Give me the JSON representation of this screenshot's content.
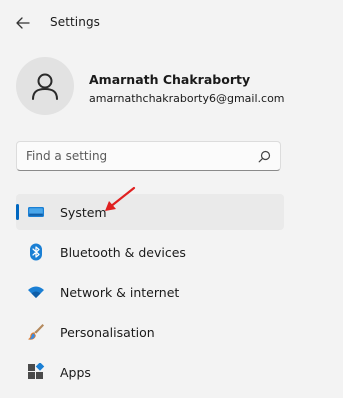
{
  "window": {
    "title": "Settings"
  },
  "user": {
    "name": "Amarnath Chakraborty",
    "email": "amarnathchakraborty6@gmail.com"
  },
  "search": {
    "placeholder": "Find a setting",
    "value": ""
  },
  "nav": {
    "items": [
      {
        "label": "System",
        "icon": "monitor-icon",
        "selected": true
      },
      {
        "label": "Bluetooth & devices",
        "icon": "bluetooth-icon",
        "selected": false
      },
      {
        "label": "Network & internet",
        "icon": "wifi-icon",
        "selected": false
      },
      {
        "label": "Personalisation",
        "icon": "brush-icon",
        "selected": false
      },
      {
        "label": "Apps",
        "icon": "apps-icon",
        "selected": false
      }
    ]
  },
  "colors": {
    "accent": "#0067c0",
    "annotation": "#e02020",
    "background": "#f3f3f3"
  }
}
